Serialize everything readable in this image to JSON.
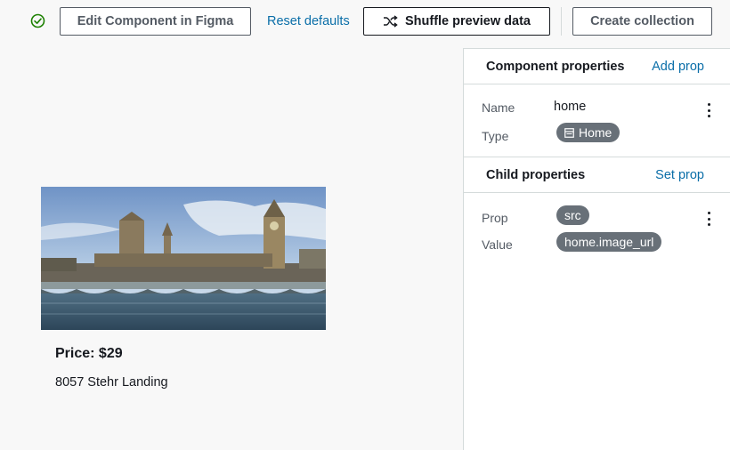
{
  "toolbar": {
    "edit_label": "Edit Component in Figma",
    "reset_label": "Reset defaults",
    "shuffle_label": "Shuffle preview data",
    "create_label": "Create collection"
  },
  "preview": {
    "price": "Price: $29",
    "address": "8057 Stehr Landing"
  },
  "component_properties": {
    "title": "Component properties",
    "action": "Add prop",
    "name_label": "Name",
    "name_value": "home",
    "type_label": "Type",
    "type_value": "Home"
  },
  "child_properties": {
    "title": "Child properties",
    "action": "Set prop",
    "prop_label": "Prop",
    "prop_value": "src",
    "value_label": "Value",
    "value_value": "home.image_url"
  },
  "icons": {
    "status": "check-circle-icon",
    "shuffle": "shuffle-icon",
    "type": "table-icon",
    "menu": "kebab-menu-icon"
  },
  "colors": {
    "link": "#0a6ea8",
    "chip": "#687078",
    "success": "#1d8102"
  }
}
